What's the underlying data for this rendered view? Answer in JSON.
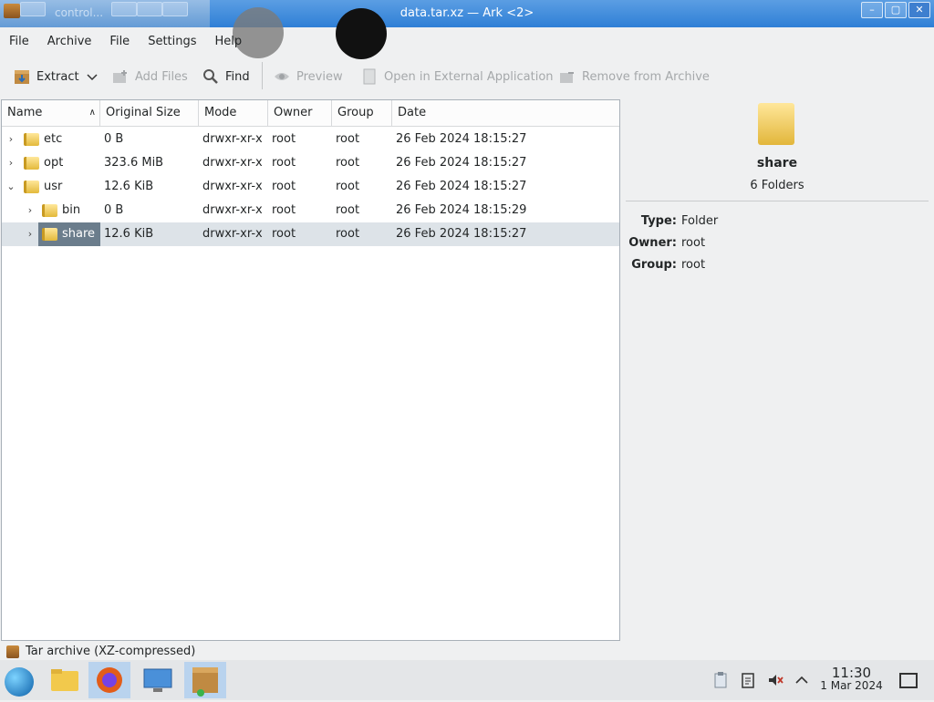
{
  "window": {
    "title": "data.tar.xz — Ark <2>",
    "ghost_title": "control..."
  },
  "menu": [
    "File",
    "Archive",
    "File",
    "Settings",
    "Help"
  ],
  "toolbar": {
    "extract": "Extract",
    "add_files": "Add Files",
    "find": "Find",
    "preview": "Preview",
    "open_external": "Open in External Application",
    "remove": "Remove from Archive"
  },
  "tree": {
    "columns": [
      "Name",
      "Original Size",
      "Mode",
      "Owner",
      "Group",
      "Date"
    ],
    "rows": [
      {
        "name": "etc",
        "size": "0 B",
        "mode": "drwxr-xr-x",
        "owner": "root",
        "group": "root",
        "date": "26 Feb 2024 18:15:27"
      },
      {
        "name": "opt",
        "size": "323.6 MiB",
        "mode": "drwxr-xr-x",
        "owner": "root",
        "group": "root",
        "date": "26 Feb 2024 18:15:27"
      },
      {
        "name": "usr",
        "size": "12.6 KiB",
        "mode": "drwxr-xr-x",
        "owner": "root",
        "group": "root",
        "date": "26 Feb 2024 18:15:27"
      },
      {
        "name": "bin",
        "size": "0 B",
        "mode": "drwxr-xr-x",
        "owner": "root",
        "group": "root",
        "date": "26 Feb 2024 18:15:29"
      },
      {
        "name": "share",
        "size": "12.6 KiB",
        "mode": "drwxr-xr-x",
        "owner": "root",
        "group": "root",
        "date": "26 Feb 2024 18:15:27"
      }
    ]
  },
  "info": {
    "name": "share",
    "summary": "6 Folders",
    "type_label": "Type:",
    "type_value": "Folder",
    "owner_label": "Owner:",
    "owner_value": "root",
    "group_label": "Group:",
    "group_value": "root"
  },
  "status": "Tar archive (XZ-compressed)",
  "taskbar": {
    "time": "11:30",
    "date": "1 Mar 2024"
  },
  "colors": {
    "titlebar": "#2f7fd6",
    "selection": "#6b7d8c",
    "folder": "#e3b93b"
  }
}
